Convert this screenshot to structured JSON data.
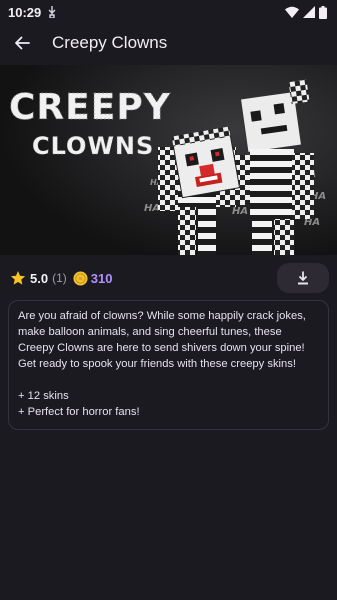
{
  "status": {
    "time": "10:29"
  },
  "header": {
    "title": "Creepy Clowns"
  },
  "banner": {
    "title_line1": "CREEPY",
    "title_line2": "CLOWNS",
    "laugh": "HA"
  },
  "info": {
    "rating": "5.0",
    "rating_count": "(1)",
    "price": "310"
  },
  "description": {
    "paragraph_lines": [
      "Are you afraid of clowns? While some happily crack jokes,",
      "make balloon animals, and sing cheerful tunes, these",
      "Creepy Clowns are here to send shivers down your spine!",
      "Get ready to spook your friends with these creepy skins!"
    ],
    "bullets": [
      "+ 12 skins",
      "+ Perfect for horror fans!"
    ]
  },
  "colors": {
    "accent": "#b190ff",
    "background": "#1c1a21",
    "star": "#f7c325",
    "coin": "#f2c230"
  },
  "icons": [
    "usb-icon",
    "wifi-icon",
    "signal-icon",
    "battery-icon",
    "back-arrow-icon",
    "star-icon",
    "coin-icon",
    "download-icon"
  ]
}
